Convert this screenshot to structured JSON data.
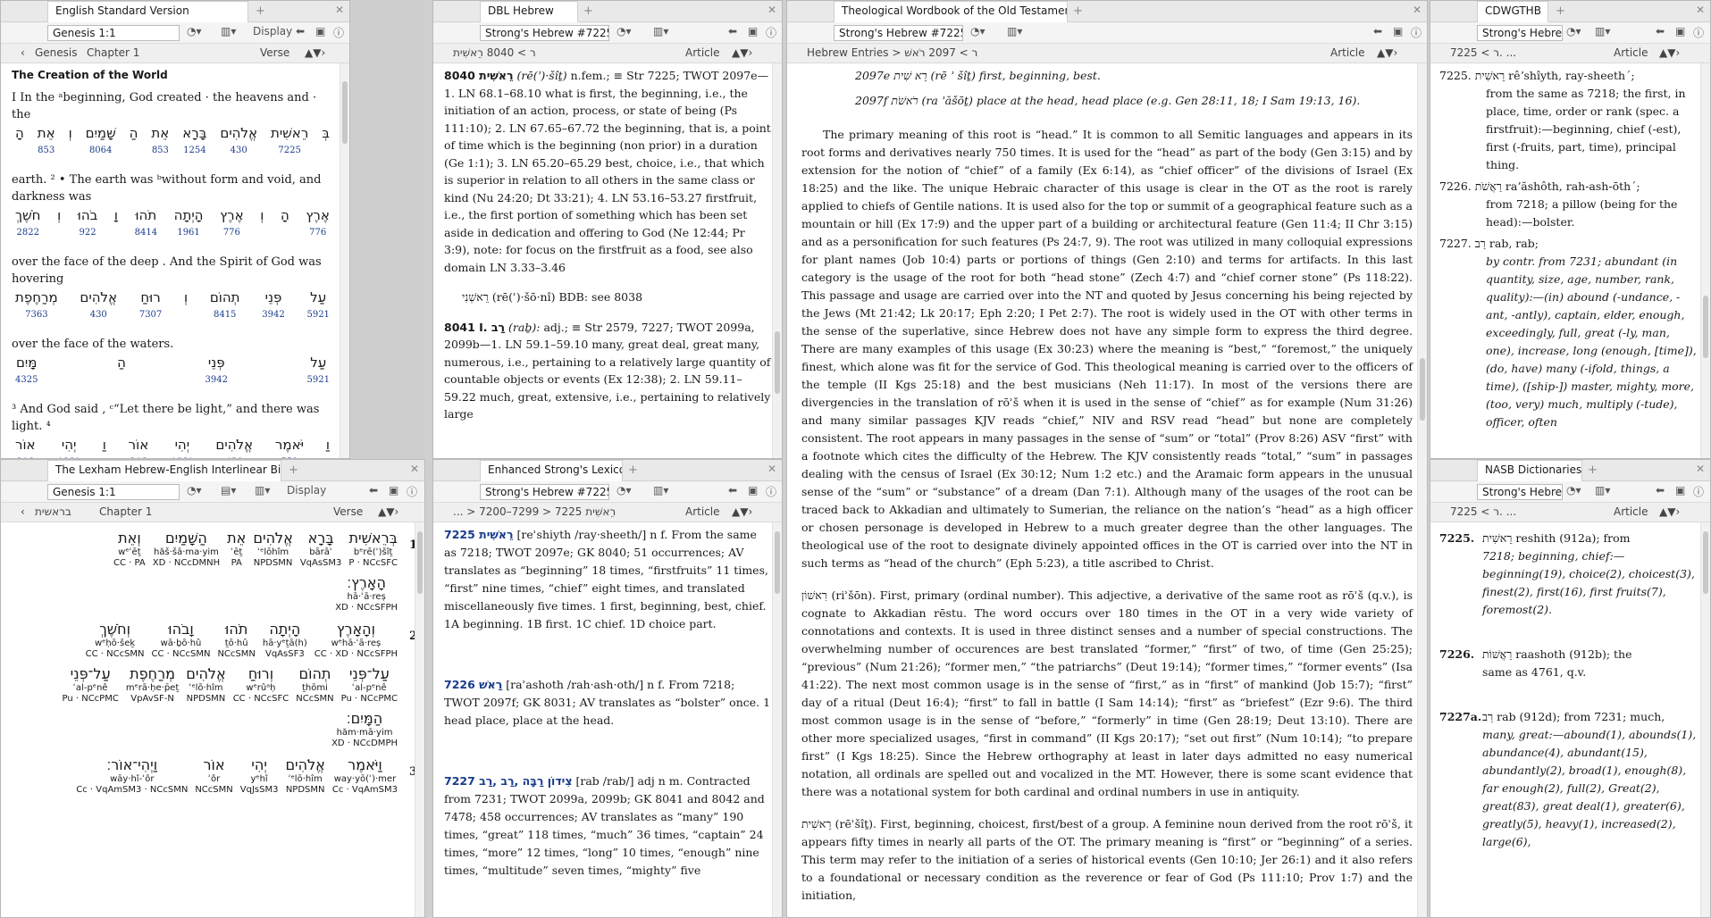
{
  "panels": {
    "esv": {
      "tab": "English Standard Version",
      "ref": "Genesis 1:1",
      "display": "Display",
      "nav_book": "Genesis",
      "nav_chapter": "Chapter 1",
      "nav_mode": "Verse",
      "heading": "The Creation of the World",
      "lines": [
        {
          "en": "I In the ᵃbeginning, God created · the heavens and · the",
          "heb": [
            "בְּ",
            "רֵאשִׁית",
            "אֱלֹהִים",
            "בָּרָא",
            "אֵת",
            "הַ",
            "שָּׁמַיִם",
            "וְ",
            "אֵת",
            "הָ"
          ],
          "nums": [
            "",
            "7225",
            "430",
            "1254",
            "853",
            "",
            "8064",
            "",
            "853",
            ""
          ]
        },
        {
          "en": "earth. ² • The earth was ᵇwithout form and void, and darkness was",
          "heb": [
            "אֶרֶץ",
            "הָ",
            "וְ",
            "אֶרֶץ",
            "הָיְתָה",
            "תֹהוּ",
            "וָ",
            "בֹהוּ",
            "וְ",
            "חֹשֶׁךְ"
          ],
          "nums": [
            "776",
            "",
            "",
            "776",
            "1961",
            "8414",
            "",
            "922",
            "",
            "2822"
          ]
        },
        {
          "en": "over the face of the deep . And the Spirit of God was hovering",
          "heb": [
            "עַל",
            "פְּנֵי",
            "תְהוֹם",
            "וְ",
            "רוּחַ",
            "אֱלֹהִים",
            "מְרַחֶפֶת"
          ],
          "nums": [
            "5921",
            "3942",
            "8415",
            "",
            "7307",
            "430",
            "7363"
          ]
        },
        {
          "en": "over the face of the waters.",
          "heb": [
            "עַל",
            "פְּנֵי",
            "הַ",
            "מָּיִם"
          ],
          "nums": [
            "5921",
            "3942",
            "",
            "4325"
          ]
        },
        {
          "en": "³ And God said , ᶜ“Let there be light,” and there was light. ⁴",
          "heb": [
            "וַ",
            "יֹּאמֶר",
            "אֱלֹהִים",
            "יְהִי",
            "אוֹר",
            "וַ",
            "יְהִי",
            "אוֹר"
          ],
          "nums": [
            "",
            "559",
            "430",
            "1961",
            "216",
            "",
            "1961",
            "216"
          ]
        }
      ]
    },
    "dbl": {
      "tab": "DBL Hebrew",
      "ref": "Strong's Hebrew #7225",
      "nav_path": "ר > 8040 רֵאשִׁית",
      "nav_mode": "Article",
      "entry1_head": "8040 רֵאשִׁית",
      "entry1_pron": "(rē(ʾ)·šîṯ)",
      "entry1_body": "n.fem.; ≡ Str 7225; TWOT 2097e—1. LN 68.1–68.10 what is first, the beginning, i.e., the initiation of an action, process, or state of being (Ps 111:10); 2. LN 67.65–67.72 the beginning, that is, a point of time which is the beginning (non prior) in a duration (Ge 1:1); 3. LN 65.20–65.29 best, choice, i.e., that which is superior in relation to all others in the same class or kind (Nu 24:20; Dt 33:21); 4. LN 53.16–53.27 firstfruit, i.e., the first portion of something which has been set aside in dedication and offering to God (Ne 12:44; Pr 3:9), note: for focus on the firstfruit as a food, see also domain LN 3.33–3.46",
      "entry1_sub": "רֵאשְׁנִי (rē(ʾ)·šō·nî) BDB: see 8038",
      "entry2_head": "8041 I. רַב",
      "entry2_pron": "(raḇ):",
      "entry2_body": "adj.; ≡ Str 2579, 7227; TWOT 2099a, 2099b—1. LN 59.1–59.10 many, great deal, great many, numerous, i.e., pertaining to a relatively large quantity of countable objects or events (Ex 12:38); 2. LN 59.11–59.22 much, great, extensive, i.e., pertaining to relatively large"
    },
    "twot": {
      "tab": "Theological Wordbook of the Old Testament",
      "ref": "Strong's Hebrew #7225",
      "nav_path": "Hebrew Entries > ר > 2097 רֹאשׁ",
      "nav_mode": "Article",
      "e1": "2097e רֵא שִׁית (rē ʾ šîṯ) first, beginning, best.",
      "e2": "2097f רֹאשֹׁת (ra ʾăšōṯ) place at the head, head place (e.g. Gen 28:11, 18; I Sam 19:13, 16).",
      "p1": "The primary meaning of this root is “head.” It is common to all Semitic languages and appears in its root forms and derivatives nearly 750 times. It is used for the “head” as part of the body (Gen 3:15) and by extension for the notion of “chief” of a family (Ex 6:14), as “chief officer” of the divisions of Israel (Ex 18:25) and the like. The unique Hebraic character of this usage is clear in the OT as the root is rarely applied to chiefs of Gentile nations. It is used also for the top or summit of a geographical feature such as a mountain or hill (Ex 17:9) and the upper part of a building or architectural feature (Gen 11:4; II Chr 3:15) and as a personification for such features (Ps 24:7, 9). The root was utilized in many colloquial expressions for plant names (Job 10:4) parts or portions of things (Gen 2:10) and terms for artifacts. In this last category is the usage of the root for both “head stone” (Zech 4:7) and “chief corner stone” (Ps 118:22). This passage and usage are carried over into the NT and quoted by Jesus concerning his being rejected by the Jews (Mt 21:42; Lk 20:17; Eph 2:20; I Pet 2:7). The root is widely used in the OT with other terms in the sense of the superlative, since Hebrew does not have any simple form to express the third degree. There are many examples of this usage (Ex 30:23) where the meaning is “best,” “foremost,” the uniquely finest, which alone was fit for the service of God. This theological meaning is carried over to the officers of the temple (II Kgs 25:18) and the best musicians (Neh 11:17). In most of the versions there are divergencies in the translation of rōʾš when it is used in the sense of “chief” as for example (Num 31:26) and many similar passages KJV reads “chief,” NIV and RSV read “head” but none are completely consistent. The root appears in many passages in the sense of “sum” or “total” (Prov 8:26) ASV “first” with a footnote which cites the difficulty of the Hebrew. The KJV consistently reads “total,” “sum” in passages dealing with the census of Israel (Ex 30:12; Num 1:2 etc.) and the Aramaic form appears in the unusual sense of the “sum” or “substance” of a dream (Dan 7:1). Although many of the usages of the root can be traced back to Akkadian and ultimately to Sumerian, the reliance on the nation’s “head” as a high officer or chosen personage is developed in Hebrew to a much greater degree than the other languages. The theological use of the root to designate divinely appointed offices in the OT is carried over into the NT in such terms as “head of the church” (Eph 5:23), a title ascribed to Christ.",
      "p2": "רִאשׁוֹן (riʾšōn). First, primary (ordinal number). This adjective, a derivative of the same root as rōʾš (q.v.), is cognate to Akkadian rēstu. The word occurs over 180 times in the OT in a very wide variety of connotations and contexts. It is used in three distinct senses and a number of special constructions. The overwhelming number of occurences are best translated “former,” “first” of two, of time (Gen 25:25); “previous” (Num 21:26); “former men,” “the patriarchs” (Deut 19:14); “former times,” “former events” (Isa 41:22). The next most common usage is in the sense of “first,” as in “first” of mankind (Job 15:7); “first” day of a ritual (Deut 16:4); “first” to fall in battle (I Sam 14:14); “first” as “briefest” (Ezr 9:6). The third most common usage is in the sense of “before,” “formerly” in time (Gen 28:19; Deut 13:10). There are other more specialized usages, “first in command” (II Kgs 20:17); “set out first” (Num 10:14); “to prepare first” (I Kgs 18:25). Since the Hebrew orthography at least in later days admitted no easy numerical notation, all ordinals are spelled out and vocalized in the MT. However, there is some scant evidence that there was a notational system for both cardinal and ordinal numbers in use in antiquity.",
      "p3": "רֵאשִׁית (rēʾšîṯ). First, beginning, choicest, first/best of a group. A feminine noun derived from the root rōʾš, it appears fifty times in nearly all parts of the OT. The primary meaning is “first” or “beginning” of a series. This term may refer to the initiation of a series of historical events (Gen 10:10; Jer 26:1) and it also refers to a foundational or necessary condition as the reverence or fear of God (Ps 111:10; Prov 1:7) and the initiation,"
    },
    "cdw": {
      "tab": "CDWGTHB",
      "ref": "Strong's Hebrew #72",
      "nav_path": "ר > 7225. ...",
      "nav_mode": "Article",
      "e1_head": "7225. רֵאשִׁית rêʼshîyth, ray-sheeth´;",
      "e1_body": "from the same as 7218; the first, in place, time, order or rank (spec. a firstfruit):—beginning, chief (-est), first (-fruits, part, time), principal thing.",
      "e2_head": "7226. רַאֲשֹׁת raʼăshôth, rah-ash-ōth´;",
      "e2_body": "from 7218; a pillow (being for the head):—bolster.",
      "e3_head": "7227. רַב rab, rab;",
      "e3_body": "by contr. from 7231; abundant (in quantity, size, age, number, rank, quality):—(in) abound (-undance, -ant, -antly), captain, elder, enough, exceedingly, full, great (-ly, man, one), increase, long (enough, [time]), (do, have) many (-ifold, things, a time), ([ship-]) master, mighty, more, (too, very) much, multiply (-tude), officer, often"
    },
    "lhi": {
      "tab": "The Lexham Hebrew-English Interlinear Bible",
      "ref": "Genesis 1:1",
      "display": "Display",
      "nav_book": "בראשית",
      "nav_chapter": "Chapter 1",
      "nav_mode": "Verse",
      "verses": [
        {
          "num": "1",
          "rows": [
            [
              {
                "h": "בְּרֵאשִׁית",
                "t": "bᵉrē(ʾ)šîṯ",
                "m": "P · NCcSFC"
              },
              {
                "h": "בָּרָא",
                "t": "bārāʾ",
                "m": "VqAsSM3"
              },
              {
                "h": "אֱלֹהִים",
                "t": "ʾᵉlōhîm",
                "m": "NPDSMN"
              },
              {
                "h": "אֵת",
                "t": "ʾēṯ",
                "m": "PA"
              },
              {
                "h": "הַשָּׁמַיִם",
                "t": "hăš·šā·ma·yim",
                "m": "XD · NCcDMNH"
              },
              {
                "h": "וְאֵת",
                "t": "wᵉʾēṯ",
                "m": "CC · PA"
              }
            ],
            [
              {
                "h": "הָאָרֶץ׃",
                "t": "hā·ʾā·reṣ",
                "m": "XD · NCcSFPH"
              }
            ]
          ]
        },
        {
          "num": "2",
          "rows": [
            [
              {
                "h": "וְהָאָרֶץ",
                "t": "wᵉhā·ʾā·reṣ",
                "m": "CC · XD · NCcSFPH"
              },
              {
                "h": "הָיְתָה",
                "t": "hā·yᵉṯā(h)",
                "m": "VqAsSF3"
              },
              {
                "h": "תֹהוּ",
                "t": "ṯō·hû",
                "m": "NCcSMN"
              },
              {
                "h": "וָבֹהוּ",
                "t": "wā·ḇō·hû",
                "m": "CC · NCcSMN"
              },
              {
                "h": "וְחֹשֶׁךְ",
                "t": "wᵉḥō·šeḵ",
                "m": "CC · NCcSMN"
              }
            ],
            [
              {
                "h": "עַל־פְּנֵי",
                "t": "ʿal-pᵉnê",
                "m": "Pu · NCcPMC"
              },
              {
                "h": "תְהוֹם",
                "t": "ṯhōmi",
                "m": "NCcSMN"
              },
              {
                "h": "וְרוּחַ",
                "t": "wᵉrûᵃḥ",
                "m": "CC · NCcSFC"
              },
              {
                "h": "אֱלֹהִים",
                "t": "ʾᵉlō·hîm",
                "m": "NPDSMN"
              },
              {
                "h": "מְרַחֶפֶת",
                "t": "mᵉrā·ḥe·p̄eṯ",
                "m": "VpAvSF-N"
              },
              {
                "h": "עַל־פְּנֵי",
                "t": "ʿal-pᵉnê",
                "m": "Pu · NCcPMC"
              }
            ],
            [
              {
                "h": "הַמָּיִם׃",
                "t": "hăm·mā·yim",
                "m": "XD · NCcDMPH"
              }
            ]
          ]
        },
        {
          "num": "3",
          "rows": [
            [
              {
                "h": "וַיֹּאמֶר",
                "t": "way·yō(ʾ)·mer",
                "m": "Cc · VqAmSM3"
              },
              {
                "h": "אֱלֹהִים",
                "t": "ʾᵉlō·hîm",
                "m": "NPDSMN"
              },
              {
                "h": "יְהִי",
                "t": "yᵉhî",
                "m": "VqJsSM3"
              },
              {
                "h": "אוֹר",
                "t": "ʾôr",
                "m": "NCcSMN"
              },
              {
                "h": "וַיְהִי־אוֹר׃",
                "t": "wāy·hî-ʾôr",
                "m": "Cc · VqAmSM3 · NCcSMN"
              }
            ]
          ]
        }
      ]
    },
    "esl": {
      "tab": "Enhanced Strong's Lexicon",
      "ref": "Strong's Hebrew #7225",
      "nav_path": "... > 7200–7299 > 7225 רֵאשִׁית",
      "nav_mode": "Article",
      "e1_head": "7225 רֵאשִׁית",
      "e1_body": "[reʾshiyth /ray·sheeth/] n f. From the same as 7218; TWOT 2097e; GK 8040; 51 occurrences; AV translates as “beginning” 18 times, “firstfruits” 11 times, “first” nine times, “chief” eight times, and translated miscellaneously five times. 1 first, beginning, best, chief. 1A beginning. 1B first. 1C chief. 1D choice part.",
      "e2_head": "7226 רַאשׁ",
      "e2_body": "[raʾashoth /rah·ash·oth/] n f. From 7218; TWOT 2097f; GK 8031; AV translates as “bolster” once. 1 head place, place at the head.",
      "e3_head": "7227 צִידוֹן רַבָּה ,רַב ,רַב",
      "e3_body": "[rab /rab/] adj n m. Contracted from 7231; TWOT 2099a, 2099b; GK 8041 and 8042 and 7478; 458 occurrences; AV translates as “many” 190 times, “great” 118 times, “much” 36 times, “captain” 24 times, “more” 12 times, “long” 10 times, “enough” nine times, “multitude” seven times, “mighty” five"
    },
    "nasb": {
      "tab": "NASB Dictionaries",
      "ref": "Strong's Hebrew #72",
      "nav_path": "ר > 7225. ...",
      "nav_mode": "Article",
      "e1_num": "7225.",
      "e1_head": "רֵאשִׁית reshith (912a); from",
      "e1_body": "7218; beginning, chief:—beginning(19), choice(2), choicest(3), finest(2), first(16), first fruits(7), foremost(2).",
      "e2_num": "7226.",
      "e2_head": "רַאֲשׁוֹת raashoth (912b); the",
      "e2_body": "same as 4761, q.v.",
      "e3_num": "7227a.",
      "e3_head": "רַב rab (912d); from 7231; much,",
      "e3_body": "many, great:—abound(1), abounds(1), abundance(4), abundant(15), abundantly(2), broad(1), enough(8), far enough(2), full(2), Great(2), great(83), great deal(1), greater(6), greatly(5), heavy(1), increased(2), large(6),"
    }
  }
}
